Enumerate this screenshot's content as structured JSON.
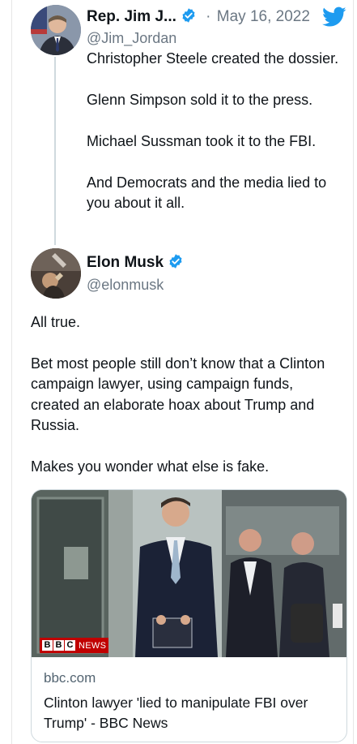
{
  "tweet1": {
    "name": "Rep. Jim J...",
    "separator": "·",
    "date": "May 16, 2022",
    "handle": "@Jim_Jordan",
    "lines": [
      "Christopher Steele created the dossier.",
      "Glenn Simpson sold it to the press.",
      "Michael Sussman took it to the FBI.",
      "And Democrats and the media lied to you about it all."
    ]
  },
  "tweet2": {
    "name": "Elon Musk",
    "handle": "@elonmusk",
    "paragraphs": [
      "All true.",
      "Bet most people still don’t know that a Clinton campaign lawyer, using campaign funds, created an elaborate hoax about Trump and Russia.",
      "Makes you wonder what else is fake."
    ]
  },
  "card": {
    "domain": "bbc.com",
    "title": "Clinton lawyer 'lied to manipulate FBI over Trump' - BBC News",
    "badge_letters": [
      "B",
      "B",
      "C"
    ],
    "badge_text": "NEWS"
  },
  "icons": {
    "verified": "verified-badge-icon",
    "twitter": "twitter-bird-icon"
  },
  "colors": {
    "verified_blue": "#1d9bf0",
    "twitter_blue": "#1d9bf0",
    "bbc_red": "#c00000",
    "muted_text": "#6b7783"
  }
}
